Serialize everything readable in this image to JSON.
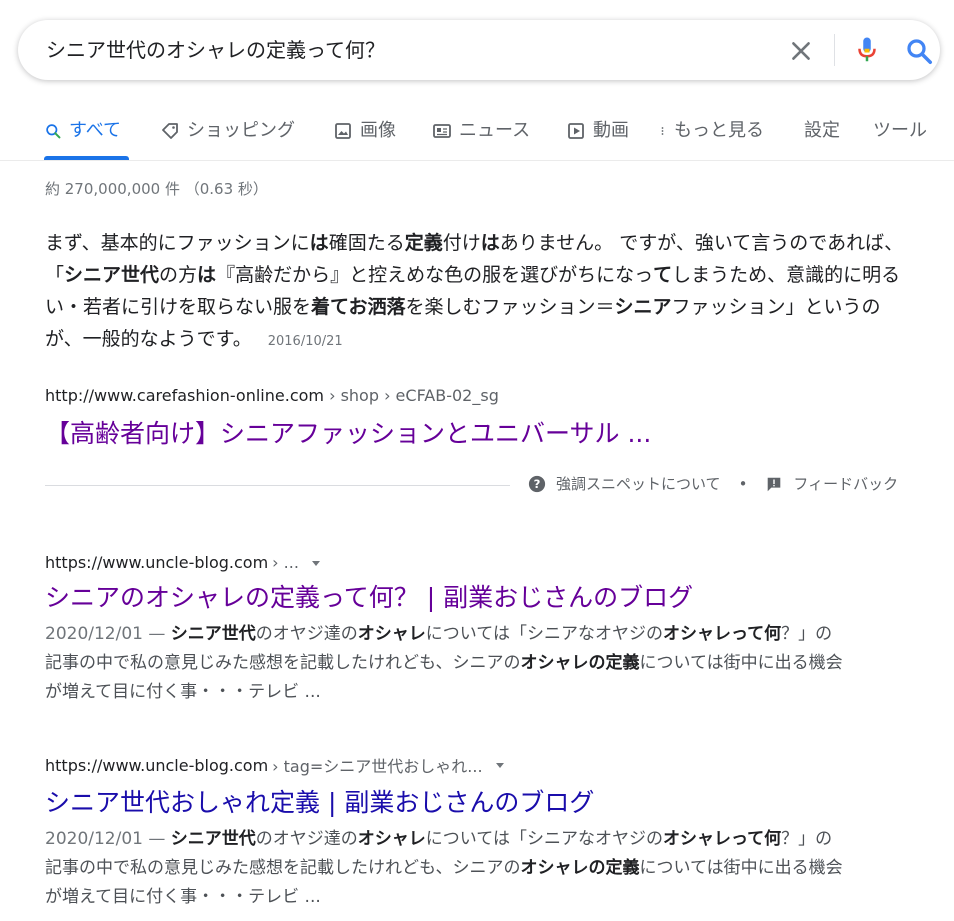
{
  "search": {
    "query": "シニア世代のオシャレの定義って何？"
  },
  "tabs": [
    {
      "label": "すべて",
      "icon": "search-icon"
    },
    {
      "label": "ショッピング",
      "icon": "tag-icon"
    },
    {
      "label": "画像",
      "icon": "image-icon"
    },
    {
      "label": "ニュース",
      "icon": "news-icon"
    },
    {
      "label": "動画",
      "icon": "video-icon"
    },
    {
      "label": "もっと見る",
      "icon": "more-vert-icon"
    },
    {
      "label": "設定"
    },
    {
      "label": "ツール"
    }
  ],
  "stats": "約 270,000,000 件 （0.63 秒）",
  "snippet": {
    "parts": [
      {
        "t": "まず、基本的にファッションに"
      },
      {
        "t": "は",
        "b": true
      },
      {
        "t": "確固たる"
      },
      {
        "t": "定義",
        "b": true
      },
      {
        "t": "付け"
      },
      {
        "t": "は",
        "b": true
      },
      {
        "t": "ありません。 ですが、強いて言うのであれば、「"
      },
      {
        "t": "シニア世代",
        "b": true
      },
      {
        "t": "の方"
      },
      {
        "t": "は",
        "b": true
      },
      {
        "t": "『高齢だから』と控えめな色の服を選びがちになっ"
      },
      {
        "t": "て",
        "b": true
      },
      {
        "t": "しまうため、意識的に明るい・若者に引けを取らない服を"
      },
      {
        "t": "着て",
        "b": true
      },
      {
        "t": "お洒落",
        "b": true
      },
      {
        "t": "を楽しむファッション＝"
      },
      {
        "t": "シニア",
        "b": true
      },
      {
        "t": "ファッション」というのが、一般的なようです。"
      }
    ],
    "date": "2016/10/21",
    "cite_domain": "http://www.carefashion-online.com",
    "cite_path": "› shop › eCFAB-02_sg",
    "title": "【高齢者向け】シニアファッションとユニバーサル ...",
    "about_label": "強調スニペットについて",
    "dot": "•",
    "feedback_label": "フィードバック"
  },
  "results": [
    {
      "cite_domain": "https://www.uncle-blog.com",
      "cite_path": "› ...",
      "title": "シニアのオシャレの定義って何？ | 副業おじさんのブログ",
      "date": "2020/12/01 — ",
      "parts": [
        {
          "t": "シニア世代",
          "b": true
        },
        {
          "t": "のオヤジ達の"
        },
        {
          "t": "オシャレ",
          "b": true
        },
        {
          "t": "については「シニアなオヤジの"
        },
        {
          "t": "オシャレって何",
          "b": true
        },
        {
          "t": "？」の記事の中で私の意見じみた感想を記載したけれども、シニアの"
        },
        {
          "t": "オシャレの定義",
          "b": true
        },
        {
          "t": "については街中に出る機会が増えて目に付く事・・・テレビ ..."
        }
      ]
    },
    {
      "cite_domain": "https://www.uncle-blog.com",
      "cite_path": "› tag=シニア世代おしゃれ...",
      "title": "シニア世代おしゃれ定義 | 副業おじさんのブログ",
      "date": "2020/12/01 — ",
      "parts": [
        {
          "t": "シニア世代",
          "b": true
        },
        {
          "t": "のオヤジ達の"
        },
        {
          "t": "オシャレ",
          "b": true
        },
        {
          "t": "については「シニアなオヤジの"
        },
        {
          "t": "オシャレって何",
          "b": true
        },
        {
          "t": "？」の記事の中で私の意見じみた感想を記載したけれども、シニアの"
        },
        {
          "t": "オシャレの定義",
          "b": true
        },
        {
          "t": "については街中に出る機会が増えて目に付く事・・・テレビ ..."
        }
      ]
    }
  ],
  "colors": {
    "accent": "#1a73e8",
    "link": "#1a0dab",
    "visited": "#660099",
    "mic_blue": "#4285f4",
    "mic_red": "#ea4335",
    "mic_yellow": "#fbbc04",
    "mic_green": "#34a853"
  }
}
